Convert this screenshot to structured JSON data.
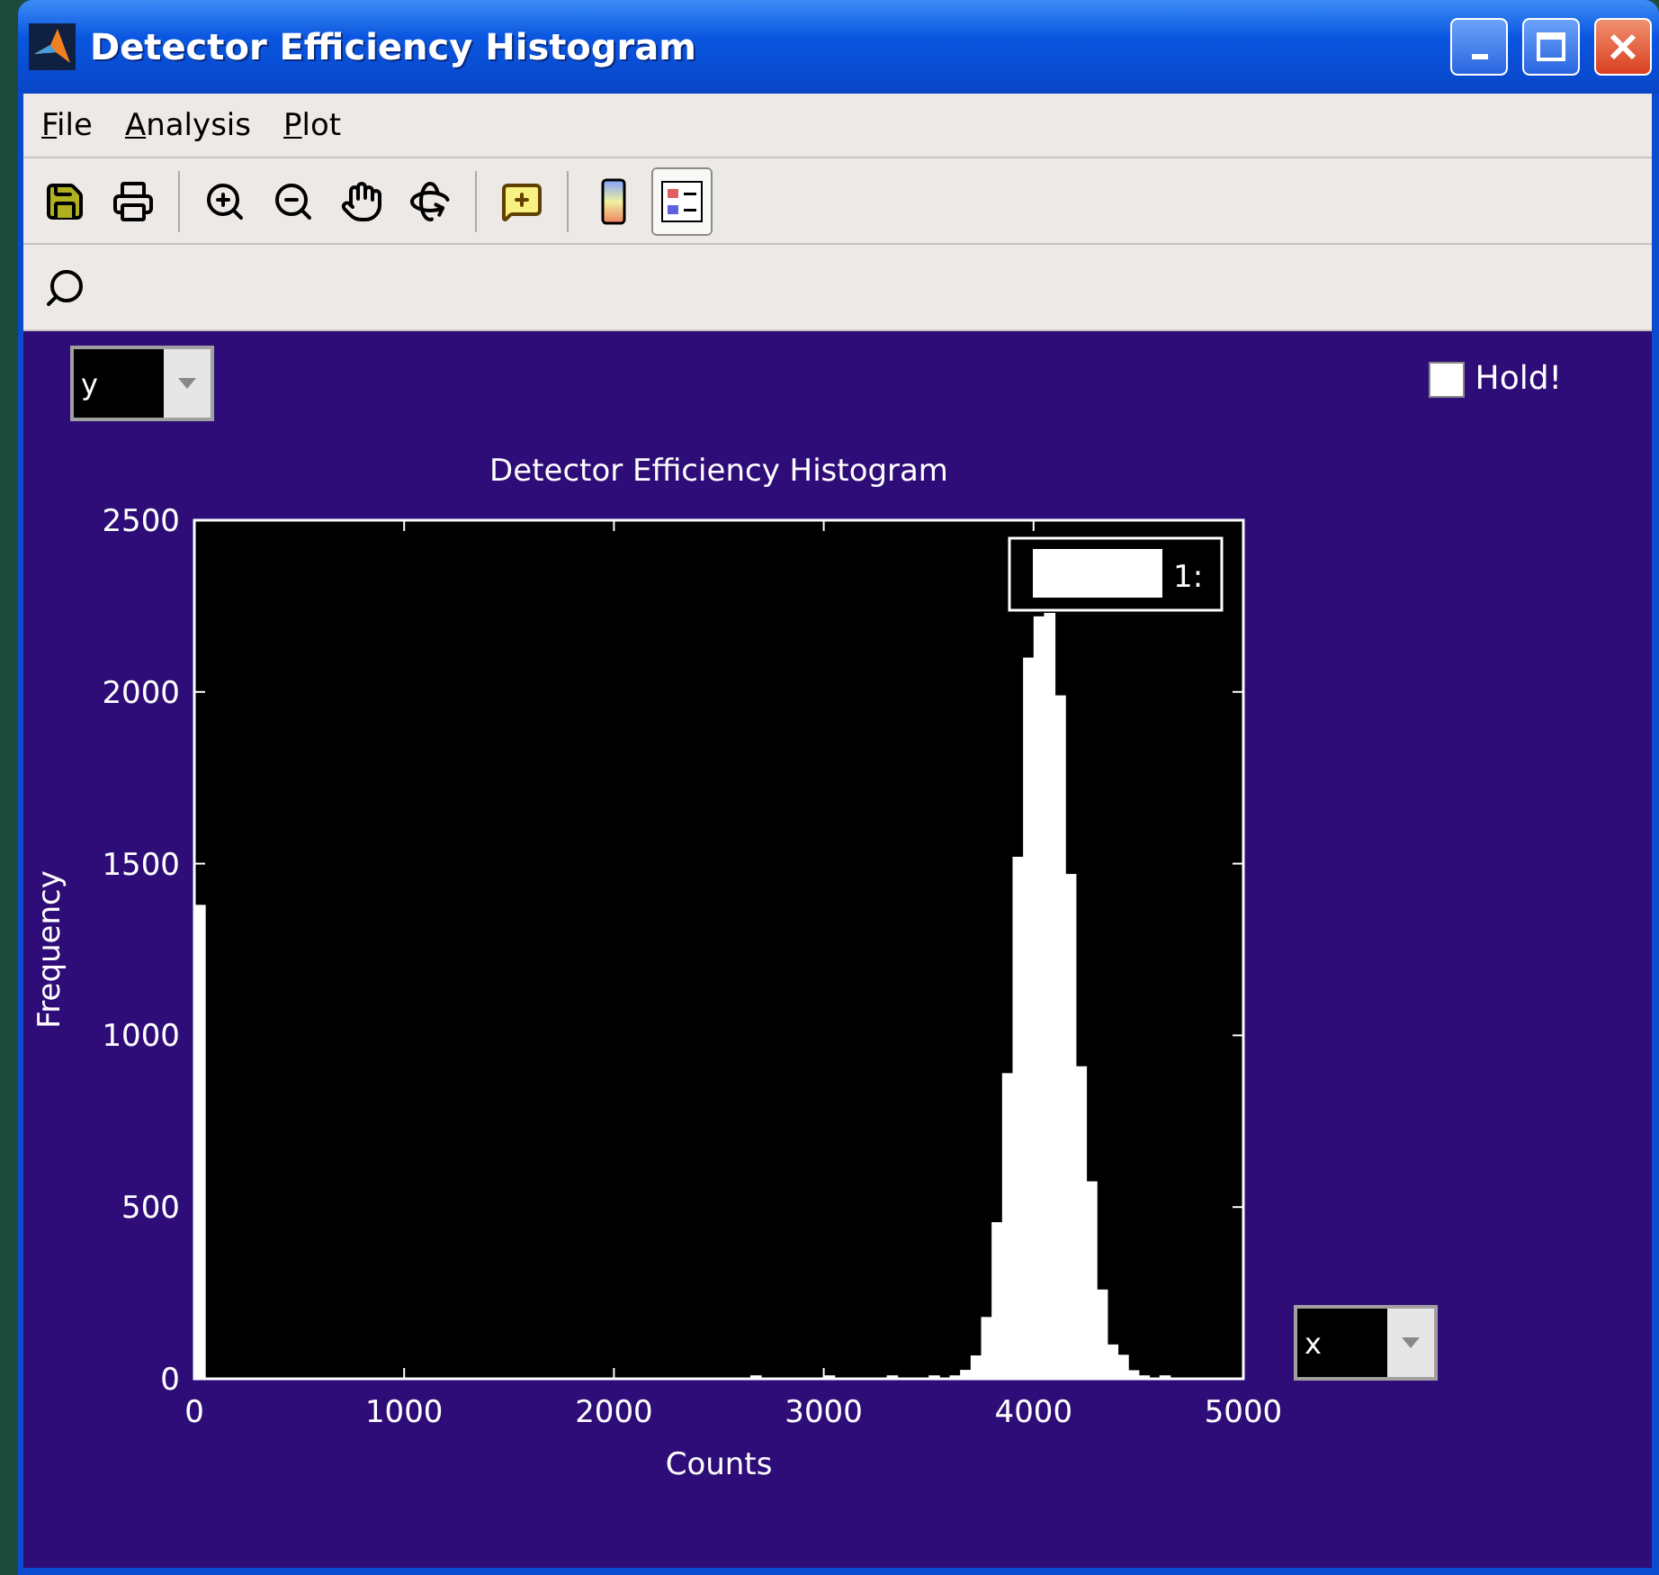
{
  "window": {
    "title": "Detector Efficiency Histogram"
  },
  "menu": [
    {
      "label": "File"
    },
    {
      "label": "Analysis"
    },
    {
      "label": "Plot"
    }
  ],
  "toolbar": [
    {
      "kind": "save",
      "selected": false
    },
    {
      "kind": "print",
      "selected": false
    },
    {
      "kind": "sep"
    },
    {
      "kind": "zoom-in",
      "selected": false
    },
    {
      "kind": "zoom-out",
      "selected": false
    },
    {
      "kind": "pan",
      "selected": false
    },
    {
      "kind": "rotate",
      "selected": false
    },
    {
      "kind": "sep"
    },
    {
      "kind": "data-cursor",
      "selected": false
    },
    {
      "kind": "sep"
    },
    {
      "kind": "colorbar",
      "selected": false
    },
    {
      "kind": "legend",
      "selected": true
    }
  ],
  "toolbar2": [
    {
      "kind": "search",
      "selected": false
    }
  ],
  "y_select": {
    "value": "y"
  },
  "x_select": {
    "value": "x"
  },
  "hold": {
    "label": "Hold!",
    "checked": false
  },
  "plot": {
    "legend": {
      "label": "1:"
    },
    "chart_data": {
      "type": "bar",
      "title": "Detector Efficiency Histogram",
      "xlabel": "Counts",
      "ylabel": "Frequency",
      "x": [
        0,
        2650,
        3000,
        3300,
        3500,
        3600,
        3650,
        3700,
        3750,
        3800,
        3850,
        3900,
        3950,
        4000,
        4050,
        4100,
        4150,
        4200,
        4250,
        4300,
        4350,
        4400,
        4450,
        4500,
        4600
      ],
      "values": [
        1380,
        10,
        10,
        10,
        10,
        10,
        26,
        68,
        180,
        456,
        890,
        1520,
        2100,
        2220,
        2230,
        1990,
        1470,
        910,
        575,
        260,
        100,
        70,
        25,
        10,
        10
      ],
      "xlim": [
        0,
        5000
      ],
      "ylim": [
        0,
        2500
      ],
      "xticks": [
        0,
        1000,
        2000,
        3000,
        4000,
        5000
      ],
      "yticks": [
        0,
        500,
        1000,
        1500,
        2000,
        2500
      ]
    }
  }
}
